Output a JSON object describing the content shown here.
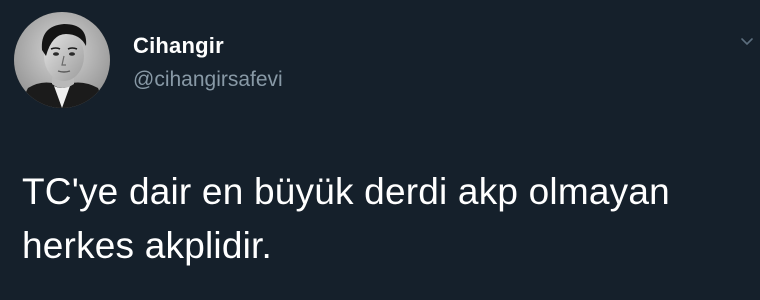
{
  "tweet": {
    "author": {
      "display_name": "Cihangir",
      "handle": "@cihangirsafevi",
      "avatar_icon": "profile-photo"
    },
    "text_lines": [
      "TC'ye dair en büyük derdi akp olmayan",
      "herkes akplidir."
    ],
    "menu_icon": "chevron-down-icon"
  },
  "theme": {
    "background": "#15202b",
    "text": "#ffffff",
    "secondary_text": "#8899a6"
  }
}
